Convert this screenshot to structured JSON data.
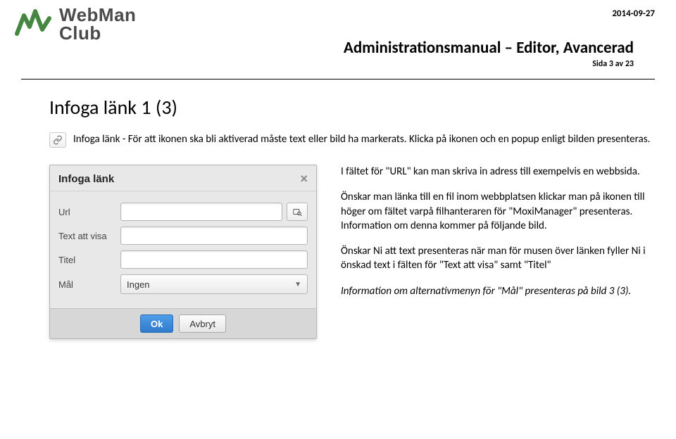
{
  "header": {
    "logo_line1": "WebMan",
    "logo_line2": "Club",
    "date": "2014-09-27",
    "title": "Administrationsmanual – Editor, Avancerad",
    "page": "Sida 3 av 23"
  },
  "section": {
    "title": "Infoga länk 1 (3)",
    "intro": "Infoga länk - För att ikonen ska bli aktiverad måste text eller bild ha markerats. Klicka på ikonen och en popup enligt bilden presenteras."
  },
  "dialog": {
    "title": "Infoga länk",
    "labels": {
      "url": "Url",
      "text": "Text att visa",
      "titel": "Titel",
      "mal": "Mål"
    },
    "mal_value": "Ingen",
    "ok": "Ok",
    "cancel": "Avbryt"
  },
  "explain": {
    "p1": "I fältet för \"URL\" kan man skriva in adress till exempelvis en webbsida.",
    "p2": "Önskar man länka till en fil inom webbplatsen klickar man på ikonen till höger om fältet varpå filhanteraren för \"MoxiManager\" presenteras. Information om denna kommer på följande bild.",
    "p3": "Önskar Ni att text presenteras när man för musen över länken fyller Ni i önskad text i fälten för \"Text att visa\" samt \"Titel\"",
    "p4": "Information om alternativmenyn för \"Mål\" presenteras på bild 3 (3)."
  }
}
